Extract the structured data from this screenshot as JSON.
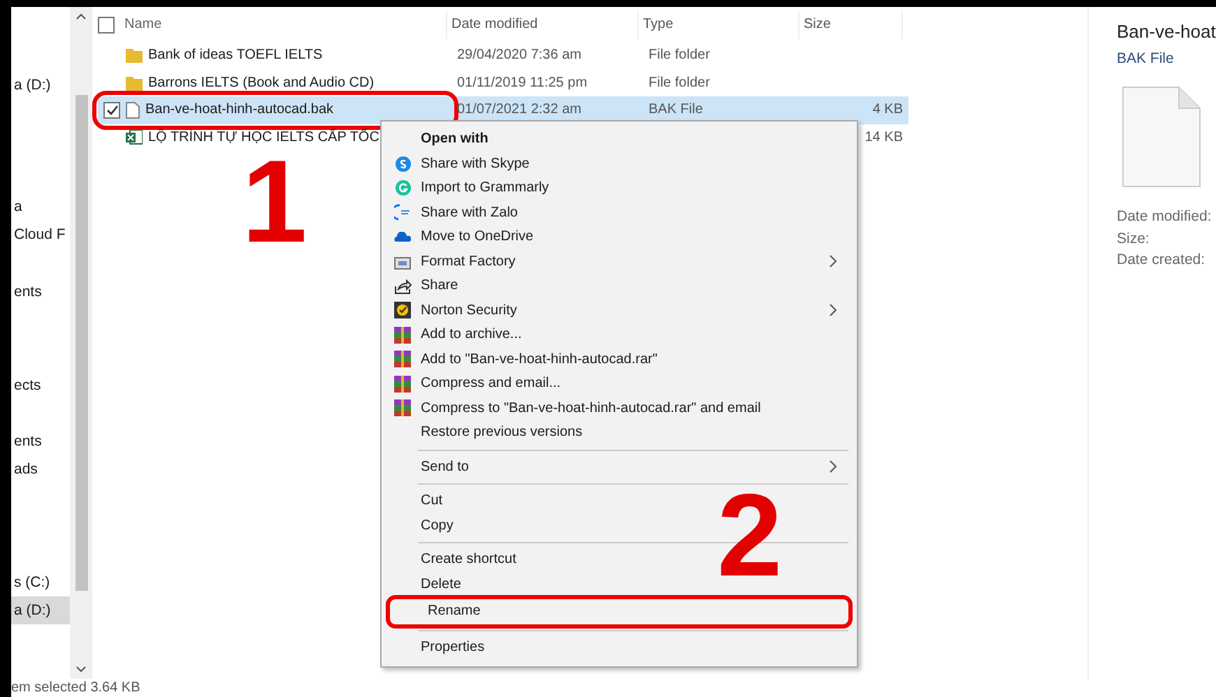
{
  "nav_pane": {
    "items": [
      {
        "label": "a (D:)",
        "selected": false
      },
      {
        "label": "a",
        "selected": false
      },
      {
        "label": "Cloud F",
        "selected": false
      },
      {
        "label": "ents",
        "selected": false
      },
      {
        "label": "ects",
        "selected": false
      },
      {
        "label": "ents",
        "selected": false
      },
      {
        "label": "ads",
        "selected": false
      },
      {
        "label": "s (C:)",
        "selected": false
      },
      {
        "label": "a (D:)",
        "selected": true
      }
    ]
  },
  "file_list": {
    "all_checked": false,
    "columns": [
      "Name",
      "Date modified",
      "Type",
      "Size"
    ],
    "rows": [
      {
        "kind": "folder",
        "name": "Bank of ideas TOEFL IELTS",
        "date": "29/04/2020 7:36 am",
        "type": "File folder",
        "size": "",
        "selected": false,
        "checked": false,
        "annotated": false
      },
      {
        "kind": "folder",
        "name": "Barrons IELTS (Book and Audio CD)",
        "date": "01/11/2019 11:25 pm",
        "type": "File folder",
        "size": "",
        "selected": false,
        "checked": false,
        "annotated": false
      },
      {
        "kind": "file",
        "name": "Ban-ve-hoat-hinh-autocad.bak",
        "date": "01/07/2021 2:32 am",
        "type": "BAK File",
        "size": "4 KB",
        "selected": true,
        "checked": true,
        "annotated": true
      },
      {
        "kind": "excel",
        "name": "LỘ TRÌNH TỰ HỌC IELTS CẤP TỐC",
        "date": "",
        "type": "",
        "size": "14 KB",
        "selected": false,
        "checked": false,
        "annotated": false
      }
    ]
  },
  "context_menu": {
    "groups": [
      [
        {
          "label": "Open with",
          "kind": "heading",
          "submenu": false,
          "annotated": false
        },
        {
          "label": "Share with Skype",
          "kind": "skype",
          "submenu": false,
          "annotated": false
        },
        {
          "label": "Import to Grammarly",
          "kind": "grammarly",
          "submenu": false,
          "annotated": false
        },
        {
          "label": "Share with Zalo",
          "kind": "zalo",
          "submenu": false,
          "annotated": false
        },
        {
          "label": "Move to OneDrive",
          "kind": "cloud",
          "submenu": false,
          "annotated": false
        },
        {
          "label": "Format Factory",
          "kind": "factory",
          "submenu": true,
          "annotated": false
        },
        {
          "label": "Share",
          "kind": "share",
          "submenu": false,
          "annotated": false
        },
        {
          "label": "Norton Security",
          "kind": "norton",
          "submenu": true,
          "annotated": false
        },
        {
          "label": "Add to archive...",
          "kind": "archive",
          "submenu": false,
          "annotated": false
        },
        {
          "label": "Add to \"Ban-ve-hoat-hinh-autocad.rar\"",
          "kind": "archive",
          "submenu": false,
          "annotated": false
        },
        {
          "label": "Compress and email...",
          "kind": "archive",
          "submenu": false,
          "annotated": false
        },
        {
          "label": "Compress to \"Ban-ve-hoat-hinh-autocad.rar\" and email",
          "kind": "archive",
          "submenu": false,
          "annotated": false
        },
        {
          "label": "Restore previous versions",
          "kind": "plain",
          "submenu": false,
          "annotated": false
        }
      ],
      [
        {
          "label": "Send to",
          "kind": "plain",
          "submenu": true,
          "annotated": false
        }
      ],
      [
        {
          "label": "Cut",
          "kind": "plain",
          "submenu": false,
          "annotated": false
        },
        {
          "label": "Copy",
          "kind": "plain",
          "submenu": false,
          "annotated": false
        }
      ],
      [
        {
          "label": "Create shortcut",
          "kind": "plain",
          "submenu": false,
          "annotated": false
        },
        {
          "label": "Delete",
          "kind": "plain",
          "submenu": false,
          "annotated": false
        },
        {
          "label": "Rename",
          "kind": "plain",
          "submenu": false,
          "annotated": true
        }
      ],
      [
        {
          "label": "Properties",
          "kind": "plain",
          "submenu": false,
          "annotated": false
        }
      ]
    ]
  },
  "step_numbers": [
    "1",
    "2"
  ],
  "details_pane": {
    "title": "Ban-ve-hoat",
    "subtitle": "BAK File",
    "fields": [
      "Date modified:",
      "Size:",
      "Date created:"
    ]
  },
  "status_bar": {
    "text": "em selected  3.64 KB"
  }
}
